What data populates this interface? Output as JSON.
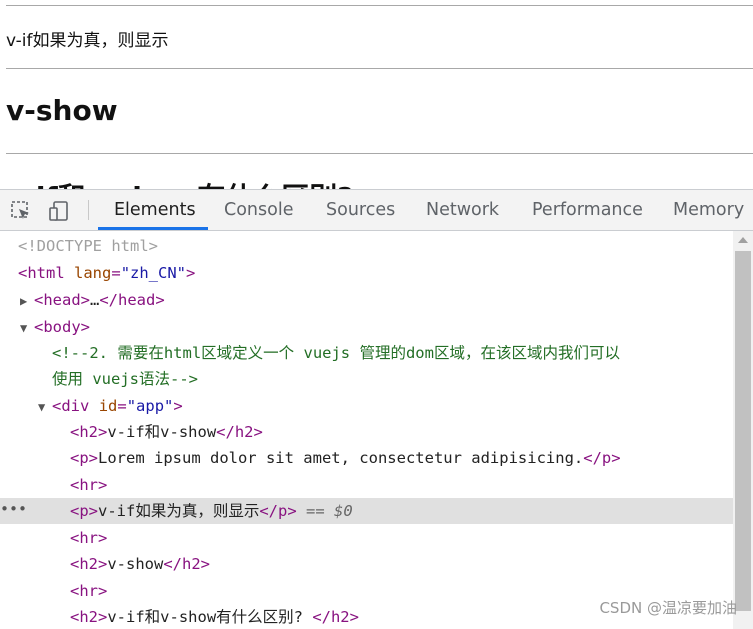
{
  "viewport": {
    "p_text": "v-if如果为真，则显示",
    "h2_show": "v-show",
    "h2_partial": "v-if和v-show有什么区别?"
  },
  "devtools": {
    "tabs": [
      {
        "label": "Elements",
        "active": true
      },
      {
        "label": "Console",
        "active": false
      },
      {
        "label": "Sources",
        "active": false
      },
      {
        "label": "Network",
        "active": false
      },
      {
        "label": "Performance",
        "active": false
      },
      {
        "label": "Memory",
        "active": false
      }
    ],
    "accent_color": "#1a73e8",
    "dom": {
      "doctype": "<!DOCTYPE html>",
      "html_open": {
        "tag": "html",
        "attr": "lang",
        "value": "\"zh_CN\""
      },
      "head": {
        "open": "<head>",
        "ellipsis": "…",
        "close": "</head>"
      },
      "body_open": "<body>",
      "comment_line1": "<!--2. 需要在html区域定义一个 vuejs 管理的dom区域，在该区域内我们可以",
      "comment_line2": "使用 vuejs语法-->",
      "div_open": {
        "tag": "div",
        "attr": "id",
        "value": "\"app\""
      },
      "h2_1_text": "v-if和v-show",
      "p_1_text": "Lorem ipsum dolor sit amet, consectetur adipisicing.",
      "p_2_text": "v-if如果为真，则显示",
      "selected_marker": "== $0",
      "h2_2_text": "v-show",
      "h2_3_text": "v-if和v-show有什么区别? ",
      "dots": "•••"
    }
  },
  "watermark": "CSDN @温凉要加油"
}
